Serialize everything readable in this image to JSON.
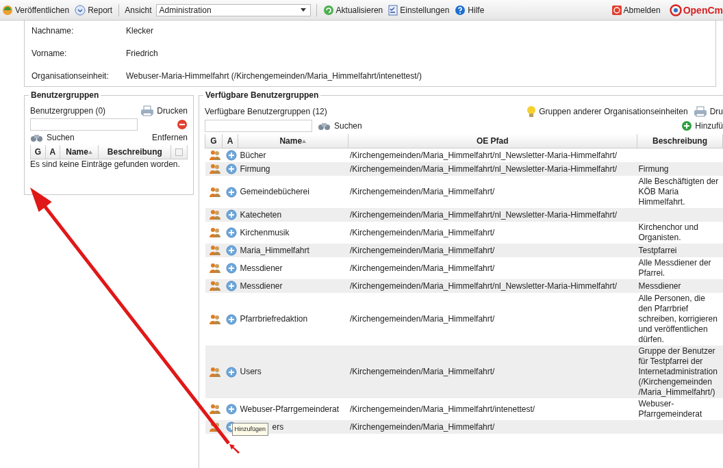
{
  "toolbar": {
    "items": [
      {
        "kind": "button",
        "label": "Veröffentlichen"
      },
      {
        "kind": "button",
        "label": "Report"
      },
      {
        "kind": "separator"
      },
      {
        "kind": "dropdown",
        "label": "Ansicht",
        "value": "Administration"
      },
      {
        "kind": "separator"
      },
      {
        "kind": "button",
        "label": "Aktualisieren"
      },
      {
        "kind": "button",
        "label": "Einstellungen"
      },
      {
        "kind": "button",
        "label": "Hilfe"
      }
    ],
    "logout": "Abmelden",
    "logo": "OpenCm"
  },
  "user_info": [
    {
      "label": "Nachname:",
      "value": "Klecker"
    },
    {
      "label": "Vorname:",
      "value": "Friedrich"
    },
    {
      "label": "Organisationseinheit:",
      "value": "Webuser-Maria-Himmelfahrt (/Kirchengemeinden/Maria_Himmelfahrt/intenettest/)"
    }
  ],
  "user_groups": {
    "legend": "Benutzergruppen",
    "count_label": "Benutzergruppen (0)",
    "print": "Drucken",
    "search": "Suchen",
    "remove": "Entfernen",
    "columns": [
      "G",
      "A",
      "Name",
      "Beschreibung"
    ],
    "select_all_checked": false,
    "empty_message": "Es sind keine Einträge gefunden worden."
  },
  "available_groups": {
    "legend": "Verfügbare Benutzergruppen",
    "count_label": "Verfügbare Benutzergruppen (12)",
    "other_units": "Gruppen anderer Organisationseinheiten",
    "print": "Dru",
    "search": "Suchen",
    "add": "Hinzufü",
    "columns": [
      "G",
      "A",
      "Name",
      "OE Pfad",
      "Beschreibung"
    ],
    "rows": [
      {
        "name": "Bücher",
        "path": "/Kirchengemeinden/Maria_Himmelfahrt/nl_Newsletter-Maria-Himmelfahrt/",
        "description": ""
      },
      {
        "name": "Firmung",
        "path": "/Kirchengemeinden/Maria_Himmelfahrt/nl_Newsletter-Maria-Himmelfahrt/",
        "description": "Firmung"
      },
      {
        "name": "Gemeindebücherei",
        "path": "/Kirchengemeinden/Maria_Himmelfahrt/",
        "description": "Alle Beschäftigten der KÖB Maria Himmelfahrt."
      },
      {
        "name": "Katecheten",
        "path": "/Kirchengemeinden/Maria_Himmelfahrt/nl_Newsletter-Maria-Himmelfahrt/",
        "description": ""
      },
      {
        "name": "Kirchenmusik",
        "path": "/Kirchengemeinden/Maria_Himmelfahrt/",
        "description": "Kirchenchor und Organisten."
      },
      {
        "name": "Maria_Himmelfahrt",
        "path": "/Kirchengemeinden/Maria_Himmelfahrt/",
        "description": "Testpfarrei"
      },
      {
        "name": "Messdiener",
        "path": "/Kirchengemeinden/Maria_Himmelfahrt/",
        "description": "Alle Messdiener der Pfarrei."
      },
      {
        "name": "Messdiener",
        "path": "/Kirchengemeinden/Maria_Himmelfahrt/nl_Newsletter-Maria-Himmelfahrt/",
        "description": "Messdiener"
      },
      {
        "name": "Pfarrbriefredaktion",
        "path": "/Kirchengemeinden/Maria_Himmelfahrt/",
        "description": "Alle Personen, die den Pfarrbrief schreiben, korrigieren und veröffentlichen dürfen."
      },
      {
        "name": "Users",
        "path": "/Kirchengemeinden/Maria_Himmelfahrt/",
        "description": "Gruppe der Benutzer für Testpfarrei der Internetadministration (/Kirchengemeinden /Maria_Himmelfahrt/)"
      },
      {
        "name": "Webuser-Pfarrgemeinderat",
        "path": "/Kirchengemeinden/Maria_Himmelfahrt/intenettest/",
        "description": "Webuser-Pfarrgemeinderat"
      },
      {
        "name": "ers",
        "path": "/Kirchengemeinden/Maria_Himmelfahrt/",
        "description": ""
      }
    ],
    "tooltip": "Hinzufügen"
  }
}
